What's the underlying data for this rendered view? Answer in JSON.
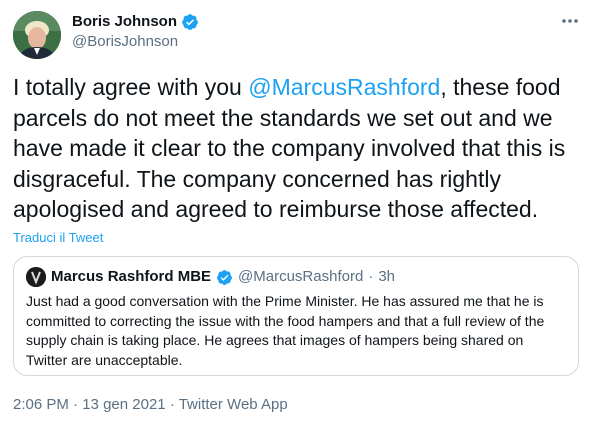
{
  "author": {
    "name": "Boris Johnson",
    "handle": "@BorisJohnson",
    "verified": true
  },
  "tweet": {
    "text_before": "I totally agree with you ",
    "mention": "@MarcusRashford",
    "text_after": ", these food parcels do not meet the standards we set out and we have made it clear to the company involved that this is disgraceful. The company concerned has rightly apologised and agreed to reimburse those affected."
  },
  "translate_label": "Traduci il Tweet",
  "quoted": {
    "name": "Marcus Rashford MBE",
    "verified": true,
    "handle": "@MarcusRashford",
    "separator": "·",
    "time": "3h",
    "text": "Just had a good conversation with the Prime Minister. He has assured me that he is committed to correcting the issue with the food hampers and that a full review of the supply chain is taking place. He agrees that images of hampers being shared on Twitter are unacceptable."
  },
  "meta": {
    "time": "2:06 PM",
    "separator": "·",
    "date": "13 gen 2021",
    "app": "Twitter Web App"
  },
  "colors": {
    "accent": "#1da1f2",
    "muted": "#5b7083",
    "text": "#0f1419",
    "border": "#cfd9de"
  },
  "icons": [
    "avatar",
    "verified-badge-icon",
    "more-options-icon"
  ]
}
